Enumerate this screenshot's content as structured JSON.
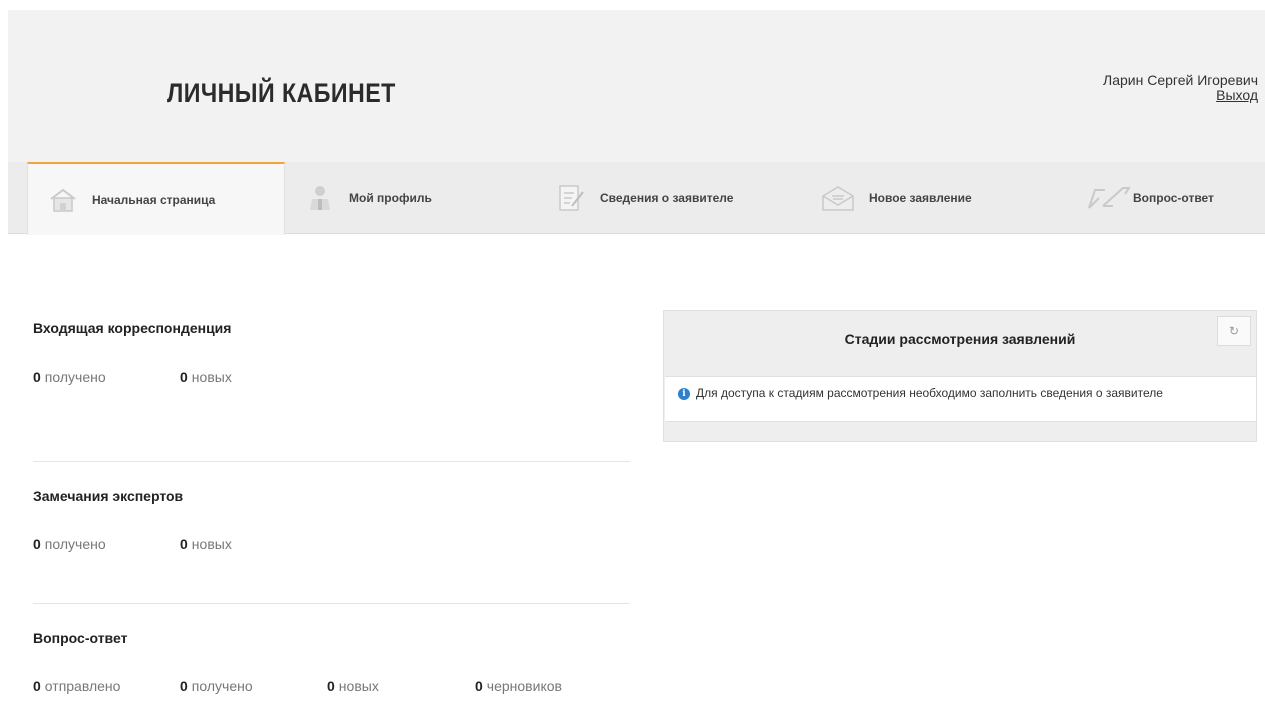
{
  "header": {
    "title": "ЛИЧНЫЙ КАБИНЕТ",
    "user_name": "Ларин Сергей Игоревич",
    "logout_label": "Выход"
  },
  "tabs": [
    {
      "label": "Начальная страница",
      "icon": "home-icon",
      "active": true
    },
    {
      "label": "Мой профиль",
      "icon": "profile-icon",
      "active": false
    },
    {
      "label": "Сведения о заявителе",
      "icon": "document-edit-icon",
      "active": false
    },
    {
      "label": "Новое заявление",
      "icon": "envelope-icon",
      "active": false
    },
    {
      "label": "Вопрос-ответ",
      "icon": "arrows-icon",
      "active": false
    }
  ],
  "stats": [
    {
      "title": "Входящая корреспонденция",
      "items": [
        {
          "value": "0",
          "label": "получено"
        },
        {
          "value": "0",
          "label": "новых"
        }
      ]
    },
    {
      "title": "Замечания экспертов",
      "items": [
        {
          "value": "0",
          "label": "получено"
        },
        {
          "value": "0",
          "label": "новых"
        }
      ]
    },
    {
      "title": "Вопрос-ответ",
      "items": [
        {
          "value": "0",
          "label": "отправлено"
        },
        {
          "value": "0",
          "label": "получено"
        },
        {
          "value": "0",
          "label": "новых"
        },
        {
          "value": "0",
          "label": "черновиков"
        }
      ]
    }
  ],
  "panel": {
    "title": "Стадии рассмотрения заявлений",
    "refresh_icon": "refresh-icon",
    "info_text": "Для доступа к стадиям рассмотрения необходимо заполнить сведения о заявителе"
  },
  "colors": {
    "accent": "#f2a43b",
    "info": "#2f7fcf"
  }
}
